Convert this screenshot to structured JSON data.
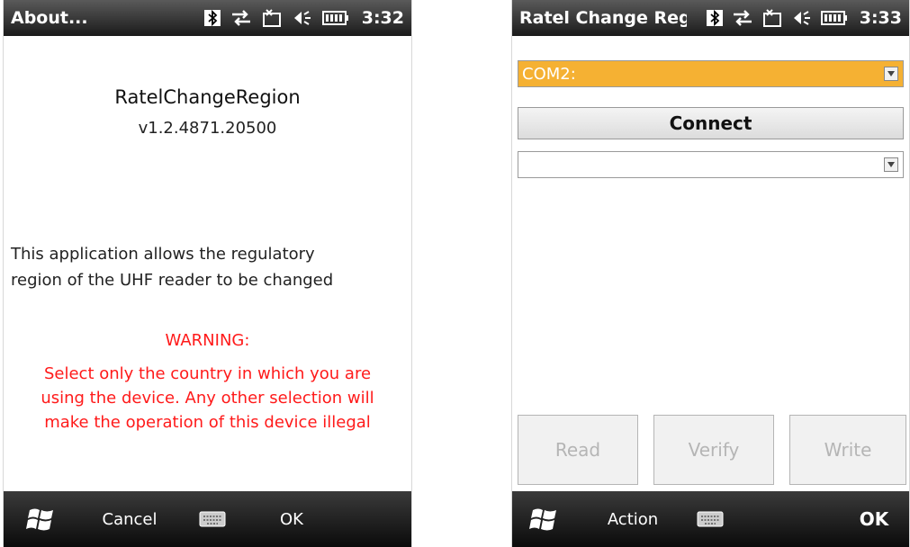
{
  "about": {
    "window_title": "About...",
    "clock": "3:32",
    "app_name": "RatelChangeRegion",
    "version": "v1.2.4871.20500",
    "description_line1": "This application allows the regulatory",
    "description_line2": "region of the UHF reader to be changed",
    "warning_heading": "WARNING:",
    "warning_line1": "Select only the country in which you are",
    "warning_line2": "using the device. Any other selection will",
    "warning_line3": "make the operation of this device illegal",
    "left_softkey": "Cancel",
    "right_softkey": "OK"
  },
  "main": {
    "window_title": "Ratel Change Regi",
    "clock": "3:33",
    "port_select_value": "COM2:",
    "connect_label": "Connect",
    "region_select_value": "",
    "read_label": "Read",
    "verify_label": "Verify",
    "write_label": "Write",
    "left_softkey": "Action",
    "right_softkey": "OK"
  },
  "colors": {
    "warning": "#ff1a1a",
    "selected_highlight": "#f5b133",
    "titlebar": "#1a1a1a"
  },
  "icons": [
    "bluetooth-icon",
    "connectivity-icon",
    "no-signal-icon",
    "volume-icon",
    "battery-icon",
    "windows-start-icon",
    "keyboard-icon",
    "dropdown-arrow-icon"
  ]
}
